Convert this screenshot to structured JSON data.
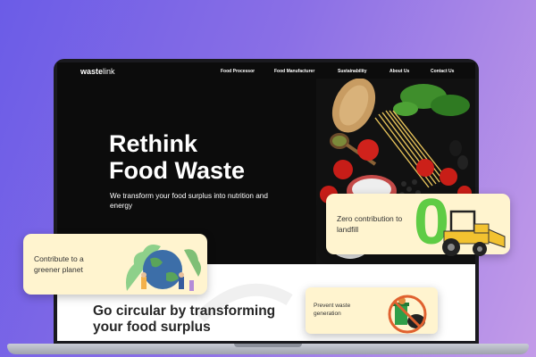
{
  "brand": {
    "logo_bold": "waste",
    "logo_thin": "link"
  },
  "nav": {
    "items": [
      {
        "label": "Food Processor"
      },
      {
        "label": "Food Manufacturer"
      },
      {
        "label": "Sustainability"
      },
      {
        "label": "About Us"
      },
      {
        "label": "Contact Us"
      }
    ]
  },
  "hero": {
    "title_line1": "Rethink",
    "title_line2": "Food Waste",
    "subtitle": "We transform your food surplus into nutrition and energy"
  },
  "cards": {
    "greener": {
      "text": "Contribute to a greener planet"
    },
    "landfill": {
      "text": "Zero contribution to landfill",
      "big_number": "0"
    },
    "prevent": {
      "text": "Prevent waste generation"
    }
  },
  "section": {
    "heading": "Go circular by transforming your food surplus"
  },
  "colors": {
    "accent_green": "#5fcc45",
    "card_bg": "#fff4cf",
    "hero_bg": "#0c0c0c"
  }
}
